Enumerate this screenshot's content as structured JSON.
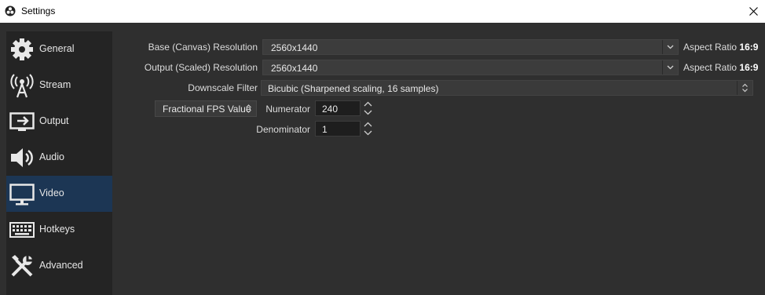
{
  "window": {
    "title": "Settings"
  },
  "sidebar": {
    "items": [
      {
        "label": "General",
        "icon": "gear-icon"
      },
      {
        "label": "Stream",
        "icon": "antenna-icon"
      },
      {
        "label": "Output",
        "icon": "output-icon"
      },
      {
        "label": "Audio",
        "icon": "speaker-icon"
      },
      {
        "label": "Video",
        "icon": "monitor-icon",
        "active": true
      },
      {
        "label": "Hotkeys",
        "icon": "keyboard-icon"
      },
      {
        "label": "Advanced",
        "icon": "tools-icon"
      }
    ]
  },
  "video": {
    "base_label": "Base (Canvas) Resolution",
    "base_value": "2560x1440",
    "base_aspect_prefix": "Aspect Ratio",
    "base_aspect_value": "16:9",
    "output_label": "Output (Scaled) Resolution",
    "output_value": "2560x1440",
    "output_aspect_prefix": "Aspect Ratio",
    "output_aspect_value": "16:9",
    "filter_label": "Downscale Filter",
    "filter_value": "Bicubic (Sharpened scaling, 16 samples)",
    "fps_type": "Fractional FPS Value",
    "numerator_label": "Numerator",
    "numerator_value": "240",
    "denominator_label": "Denominator",
    "denominator_value": "1"
  },
  "colors": {
    "active_nav": "#1c3654",
    "sidebar_bg": "#242424",
    "panel_bg": "#2f2f2f"
  }
}
